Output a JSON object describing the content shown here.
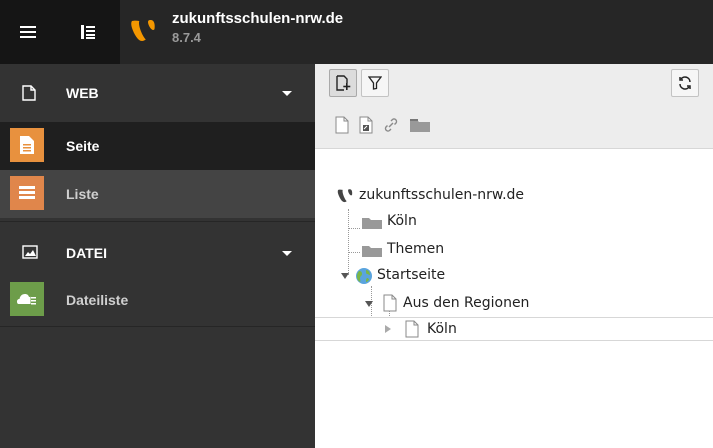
{
  "topbar": {
    "menu_icon": "hamburger-icon",
    "tree_icon": "pagetree-toggle-icon",
    "logo_icon": "typo3-logo-icon",
    "site_name": "zukunftsschulen-nrw.de",
    "version": "8.7.4"
  },
  "modules": {
    "groups": [
      {
        "label": "WEB",
        "icon": "page-icon",
        "items": [
          {
            "label": "Seite",
            "icon": "module-page-icon",
            "color": "#e8913e"
          },
          {
            "label": "Liste",
            "icon": "module-list-icon",
            "color": "#e0864b"
          }
        ]
      },
      {
        "label": "DATEI",
        "icon": "image-icon",
        "items": [
          {
            "label": "Dateiliste",
            "icon": "module-filelist-icon",
            "color": "#6d9d4a"
          }
        ]
      }
    ]
  },
  "tree_toolbar": {
    "new_page_icon": "new-page-icon",
    "filter_icon": "filter-icon",
    "refresh_icon": "refresh-icon",
    "drag_icons": [
      "doc-icon",
      "shortcut-doc-icon",
      "link-icon",
      "folder-icon"
    ]
  },
  "tree": {
    "root": "zukunftsschulen-nrw.de",
    "nodes": [
      {
        "label": "Köln",
        "icon": "folder-icon"
      },
      {
        "label": "Themen",
        "icon": "folder-icon"
      },
      {
        "label": "Startseite",
        "icon": "globe-icon"
      },
      {
        "label": "Aus den Regionen",
        "icon": "doc-icon"
      },
      {
        "label": "Köln",
        "icon": "doc-icon"
      }
    ]
  }
}
